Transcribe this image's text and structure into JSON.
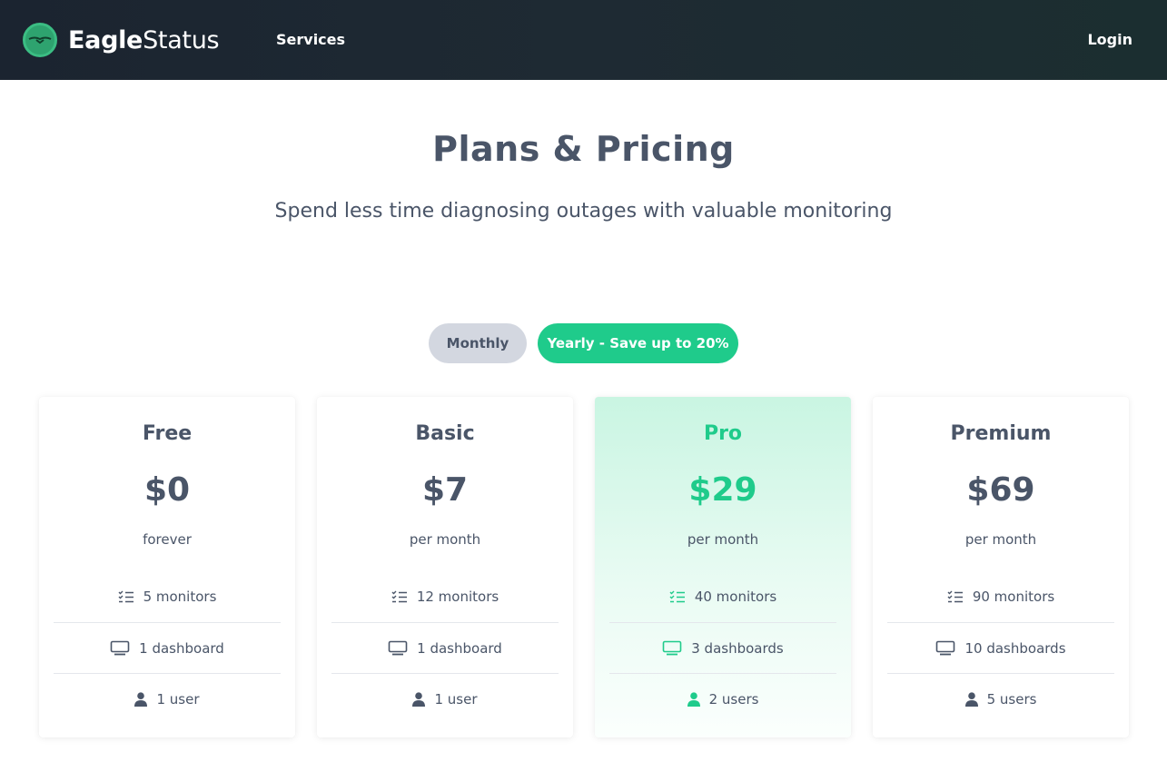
{
  "nav": {
    "brand_bold": "Eagle",
    "brand_light": "Status",
    "services_label": "Services",
    "login_label": "Login"
  },
  "hero": {
    "title": "Plans & Pricing",
    "subtitle": "Spend less time diagnosing outages with valuable monitoring"
  },
  "billing_toggle": {
    "monthly_label": "Monthly",
    "yearly_label": "Yearly - Save up to 20%",
    "selected": "yearly"
  },
  "colors": {
    "accent": "#1fcb8b",
    "text": "#4a5568",
    "nav_bg": "#1e2a33"
  },
  "plans": [
    {
      "name": "Free",
      "price": "$0",
      "period": "forever",
      "monitors": "5 monitors",
      "dashboards": "1 dashboard",
      "users": "1 user",
      "highlighted": false
    },
    {
      "name": "Basic",
      "price": "$7",
      "period": "per month",
      "monitors": "12 monitors",
      "dashboards": "1 dashboard",
      "users": "1 user",
      "highlighted": false
    },
    {
      "name": "Pro",
      "price": "$29",
      "period": "per month",
      "monitors": "40 monitors",
      "dashboards": "3 dashboards",
      "users": "2 users",
      "highlighted": true
    },
    {
      "name": "Premium",
      "price": "$69",
      "period": "per month",
      "monitors": "90 monitors",
      "dashboards": "10 dashboards",
      "users": "5 users",
      "highlighted": false
    }
  ],
  "icons": {
    "monitors": "checklist-icon",
    "dashboards": "monitor-icon",
    "users": "user-icon",
    "logo": "eagle-logo-icon"
  }
}
